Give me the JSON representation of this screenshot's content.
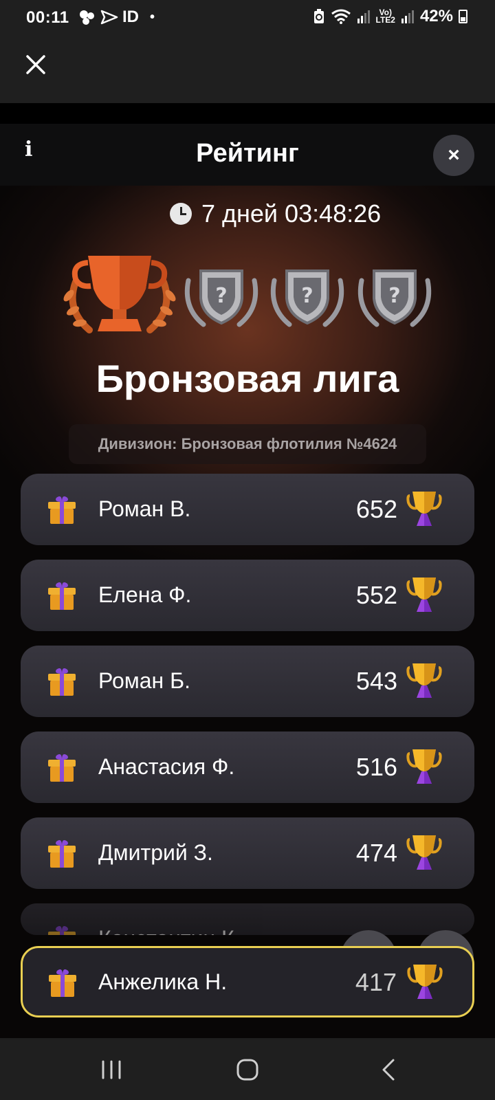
{
  "status_bar": {
    "time": "00:11",
    "indicator_text": "ID",
    "network_label_top": "Vo)",
    "network_label_bottom": "LTE2",
    "battery": "42%"
  },
  "sheet": {
    "title": "Рейтинг",
    "info_label": "i",
    "close_label": "×",
    "timer": "7 дней 03:48:26",
    "league_name": "Бронзовая лига",
    "division": "Дивизион: Бронзовая флотилия №4624"
  },
  "rows": [
    {
      "name": "Роман В.",
      "score": "652"
    },
    {
      "name": "Елена Ф.",
      "score": "552"
    },
    {
      "name": "Роман Б.",
      "score": "543"
    },
    {
      "name": "Анастасия Ф.",
      "score": "516"
    },
    {
      "name": "Дмитрий З.",
      "score": "474"
    },
    {
      "name": "Константин К.",
      "score": ""
    }
  ],
  "current_user": {
    "name": "Анжелика Н.",
    "score": "417"
  },
  "colors": {
    "accent": "#e9cf52",
    "bronze": "#e06a2a",
    "row_bg": "#2f2e35"
  }
}
